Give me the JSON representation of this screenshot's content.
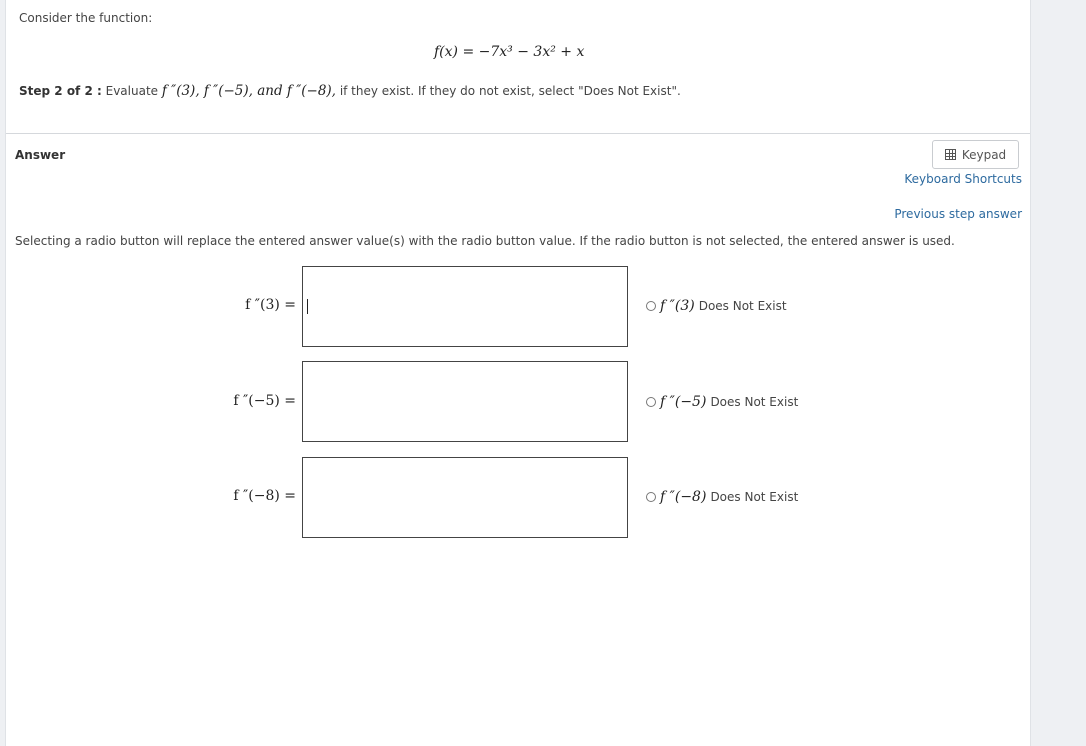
{
  "question": {
    "intro": "Consider the function:",
    "formula": "f(x) = −7x³ − 3x² + x",
    "step_label": "Step 2 of 2 :",
    "step_text_prefix": "Evaluate",
    "step_expr": "f ″(3), f ″(−5), and f ″(−8),",
    "step_text_suffix": "if they exist. If they do not exist, select \"Does Not Exist\"."
  },
  "answer": {
    "label": "Answer",
    "keypad_label": "Keypad",
    "keyboard_shortcuts": "Keyboard Shortcuts",
    "previous_step": "Previous step answer",
    "instructions": "Selecting a radio button will replace the entered answer value(s) with the radio button value. If the radio button is not selected, the entered answer is used.",
    "rows": [
      {
        "label": "f ″(3) =",
        "value": "",
        "radio_math": "f ″(3)",
        "radio_text": "Does Not Exist"
      },
      {
        "label": "f ″(−5) =",
        "value": "",
        "radio_math": "f ″(−5)",
        "radio_text": "Does Not Exist"
      },
      {
        "label": "f ″(−8) =",
        "value": "",
        "radio_math": "f ″(−8)",
        "radio_text": "Does Not Exist"
      }
    ]
  }
}
